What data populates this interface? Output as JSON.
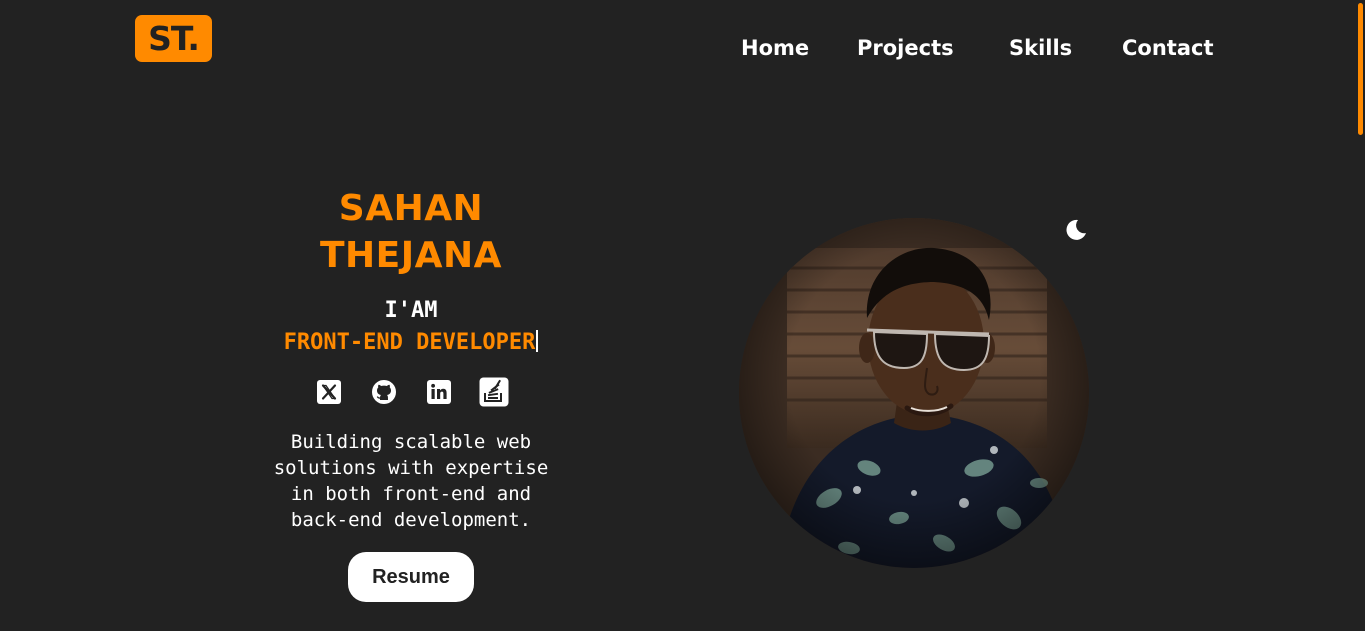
{
  "logo": {
    "text": "ST."
  },
  "nav": {
    "home": "Home",
    "projects": "Projects",
    "skills": "Skills",
    "contact": "Contact"
  },
  "hero": {
    "name_line1": "SAHAN",
    "name_line2": "THEJANA",
    "iam": "I'AM",
    "role": "FRONT-END DEVELOPER",
    "description_lines": [
      "Building scalable web",
      "solutions with expertise",
      "in both front-end and",
      "back-end development."
    ],
    "resume_label": "Resume"
  },
  "socials": [
    {
      "icon": "x-twitter-icon"
    },
    {
      "icon": "github-icon"
    },
    {
      "icon": "linkedin-icon"
    },
    {
      "icon": "stackoverflow-icon"
    }
  ],
  "theme_toggle": {
    "icon": "moon-icon"
  },
  "colors": {
    "background": "#222222",
    "accent": "#ff8a00",
    "text": "#ffffff"
  }
}
